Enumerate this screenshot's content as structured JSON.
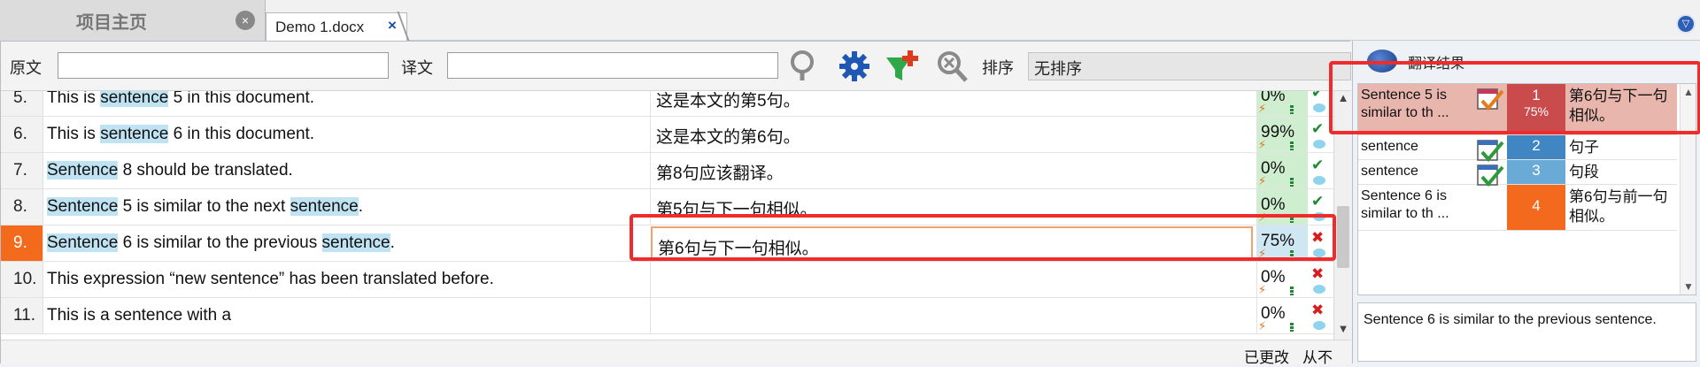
{
  "tabs": {
    "home": "项目主页",
    "home_close": "×",
    "doc": "Demo 1.docx",
    "doc_close": "×",
    "menu": "▽"
  },
  "filter": {
    "source_label": "原文",
    "target_label": "译文",
    "sort_label": "排序",
    "sort_value": "无排序",
    "source_value": "",
    "target_value": ""
  },
  "segments": [
    {
      "num": "5.",
      "src": [
        {
          "t": "This is "
        },
        {
          "t": "sentence",
          "hl": true
        },
        {
          "t": " 5 in this document."
        }
      ],
      "tgt": "这是本文的第5句。",
      "score": "0%",
      "state": "green",
      "status": "✔"
    },
    {
      "num": "6.",
      "src": [
        {
          "t": "This is "
        },
        {
          "t": "sentence",
          "hl": true
        },
        {
          "t": " 6 in this document."
        }
      ],
      "tgt": "这是本文的第6句。",
      "score": "99%",
      "state": "green",
      "status": "✔"
    },
    {
      "num": "7.",
      "src": [
        {
          "t": "Sentence",
          "hl": true
        },
        {
          "t": " 8 should be translated."
        }
      ],
      "tgt": "第8句应该翻译。",
      "score": "0%",
      "state": "green",
      "status": "✔"
    },
    {
      "num": "8.",
      "src": [
        {
          "t": "Sentence",
          "hl": true
        },
        {
          "t": " 5 is similar to the next "
        },
        {
          "t": "sentence",
          "hl": true
        },
        {
          "t": "."
        }
      ],
      "tgt": "第5句与下一句相似。",
      "score": "0%",
      "state": "green",
      "status": "✔"
    },
    {
      "num": "9.",
      "src": [
        {
          "t": "Sentence",
          "hl": true
        },
        {
          "t": " 6 is similar to the previous "
        },
        {
          "t": "sentence",
          "hl": true
        },
        {
          "t": "."
        }
      ],
      "tgt": "第6句与下一句相似。",
      "score": "75%",
      "state": "red",
      "status": "✖",
      "active": true
    },
    {
      "num": "10.",
      "src": [
        {
          "t": "This expression “new sentence” has been translated before."
        }
      ],
      "tgt": "",
      "score": "0%",
      "state": "none",
      "status": "✖"
    },
    {
      "num": "11.",
      "src": [
        {
          "t": "This is a sentence with a"
        }
      ],
      "tgt": "",
      "score": "0%",
      "state": "none",
      "status": "✖"
    }
  ],
  "statusbar": {
    "changed": "已更改",
    "never": "从不"
  },
  "results": {
    "title": "翻译结果",
    "items": [
      {
        "text": "Sentence 5 is similar to th ...",
        "rank": "1",
        "pct": "75%",
        "translation": "第6句与下一句相似。",
        "color": "#c94b4b"
      },
      {
        "text": "sentence",
        "rank": "2",
        "pct": "",
        "translation": "句子",
        "color": "#3f86c2"
      },
      {
        "text": "sentence",
        "rank": "3",
        "pct": "",
        "translation": "句段",
        "color": "#6aaad6"
      },
      {
        "text": "Sentence 6 is similar to th ...",
        "rank": "4",
        "pct": "",
        "translation": "第6句与前一句相似。",
        "color": "#f36a1f"
      }
    ],
    "preview": "Sentence 6 is similar to the previous sentence."
  }
}
